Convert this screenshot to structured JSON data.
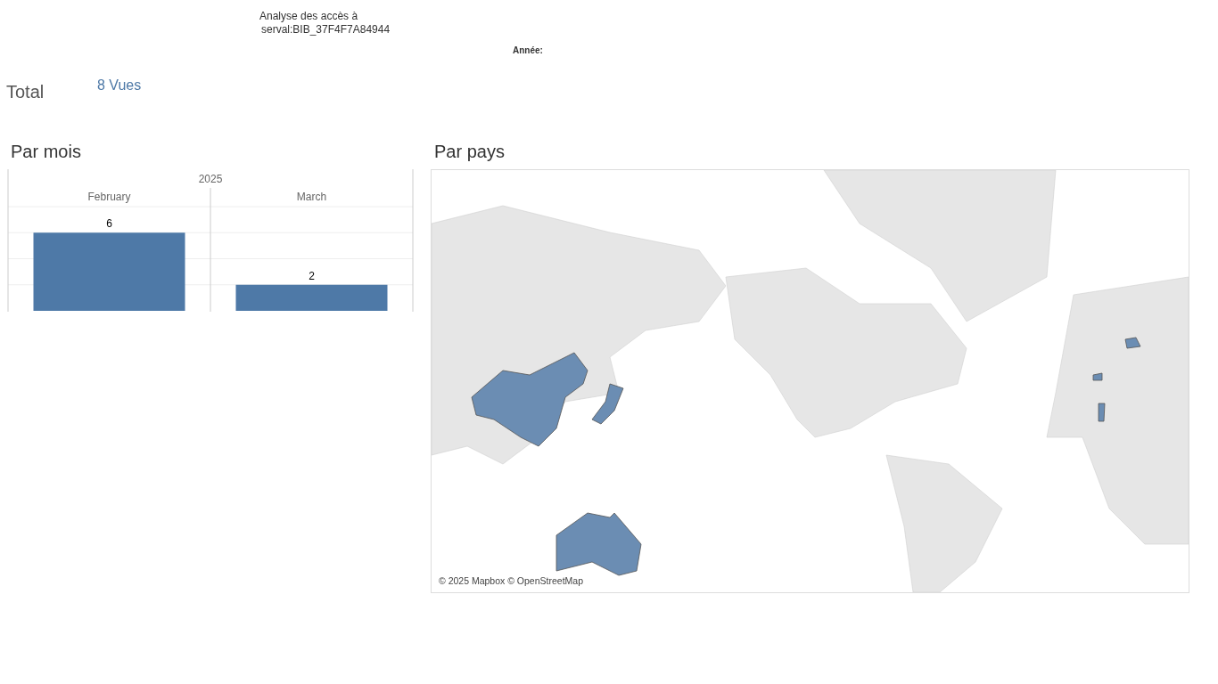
{
  "title": {
    "line_1": "Analyse des accès à",
    "line_2": "serval:BIB_37F4F7A84944"
  },
  "filter": {
    "label": "Année:"
  },
  "total": {
    "label": "Total",
    "value": "8 Vues"
  },
  "by_month": {
    "title": "Par mois",
    "header": "2025",
    "chart_data": {
      "type": "bar",
      "categories": [
        "February",
        "March"
      ],
      "ylim": [
        0,
        8
      ],
      "data_labels": true,
      "series": [
        {
          "color": "#4e79a7",
          "values": [
            6,
            2
          ]
        }
      ]
    }
  },
  "by_country": {
    "title": "Par pays",
    "attribution": "© 2025 Mapbox © OpenStreetMap"
  }
}
